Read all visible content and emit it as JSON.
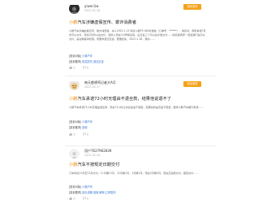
{
  "brand_color": "#f08a00",
  "button_color": "#f5a21b",
  "link_color": "#3c7bd6",
  "complaint_label": "投诉咨询",
  "complaints": [
    {
      "username": "yiwen1w",
      "date": "2022-02-16",
      "brand": "小鹏",
      "title_rest": "汽车涉嫌虚假宣传、欺诈消费者",
      "content": "小鹏汽车涉嫌虚假宣传、欺诈消费者。本人2022.1.15 购买小鹏P5 460标准版（订单号：******），购买时，商家承诺7月份可以交付，现将3月份以后交付，销售人员在3.4号联系我，后又说三个月以后才能交付……购买前商家一直和我们说可以交付，是在欺骗消费者。现要求退还定金，赔偿损失，2022-2-18，我的……",
      "fields": [
        {
          "key": "[投诉对象]",
          "value": "小鹏汽车"
        },
        {
          "key": "[投诉要求]",
          "value": "赔偿损失,退还定金"
        }
      ],
      "likes": "0",
      "comments": "0"
    },
    {
      "username": "每天都想骂记者大A月",
      "date": "2022-02-17",
      "brand": "小鹏",
      "title_rest": "汽车承诺72小时无理由不退全款，结果他说退不了",
      "content": "小鹏汽车承诺72小时无理由退全款，现在72小时之内还是说不能退，结果说的是定金不能退，要求小鹏汽车履行承诺……",
      "fields": [
        {
          "key": "[投诉对象]",
          "value": "小鹏汽车"
        },
        {
          "key": "[投诉要求]",
          "value": "退款"
        }
      ],
      "likes": "0",
      "comments": "0"
    },
    {
      "username": "用户7627962839",
      "date": "2022-02-20",
      "brand": "小鹏",
      "title_rest": "汽车不按规定日期交付",
      "content": "订车时说11月至12月交付，11月推12月，12月推1月，1月推2月，现在2月推3月，现在还没能交付，拖延交付……",
      "fields": [
        {
          "key": "[投诉对象]",
          "value": "小鹏汽车"
        },
        {
          "key": "[投诉要求]",
          "value": "赔礼道歉,退款,解释,立即整改"
        }
      ],
      "likes": "0",
      "comments": "0"
    }
  ]
}
